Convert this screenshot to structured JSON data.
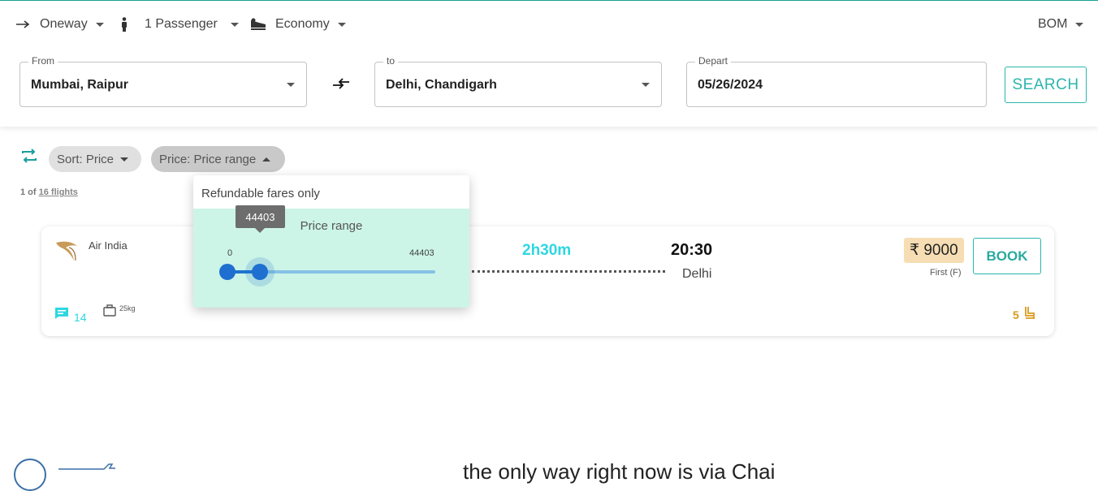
{
  "header": {
    "trip_type": "Oneway",
    "passengers": "1 Passenger",
    "cabin": "Economy",
    "currency": "BOM",
    "from": {
      "legend": "From",
      "value": "Mumbai, Raipur"
    },
    "to": {
      "legend": "to",
      "value": "Delhi, Chandigarh"
    },
    "depart": {
      "legend": "Depart",
      "value": "05/26/2024"
    },
    "search_label": "SEARCH"
  },
  "filters": {
    "sort_label": "Sort: Price",
    "price_label": "Price: Price range",
    "count_prefix": "1 of",
    "count_link": "16 flights"
  },
  "popover": {
    "refundable_label": "Refundable fares only",
    "range_title": "Price range",
    "min_label": "0",
    "max_label": "44403",
    "tooltip_value": "44403",
    "range": {
      "min": 0,
      "max": 44403,
      "low": 0,
      "high": 7000
    }
  },
  "flight": {
    "airline": "Air India",
    "duration": "2h30m",
    "arrival_time": "20:30",
    "arrival_city": "Delhi",
    "price": "₹ 9000",
    "fare_class": "First (F)",
    "book_label": "BOOK",
    "comments_count": "14",
    "baggage": "25kg",
    "seats": "5"
  },
  "footer": {
    "text": "the only way right now is via Chai"
  },
  "colors": {
    "accent": "#2bb6ac",
    "duration": "#2ed7e0",
    "slider": "#1e6fcf",
    "price_bg": "#f6ddb3",
    "seats": "#d99a1d"
  }
}
